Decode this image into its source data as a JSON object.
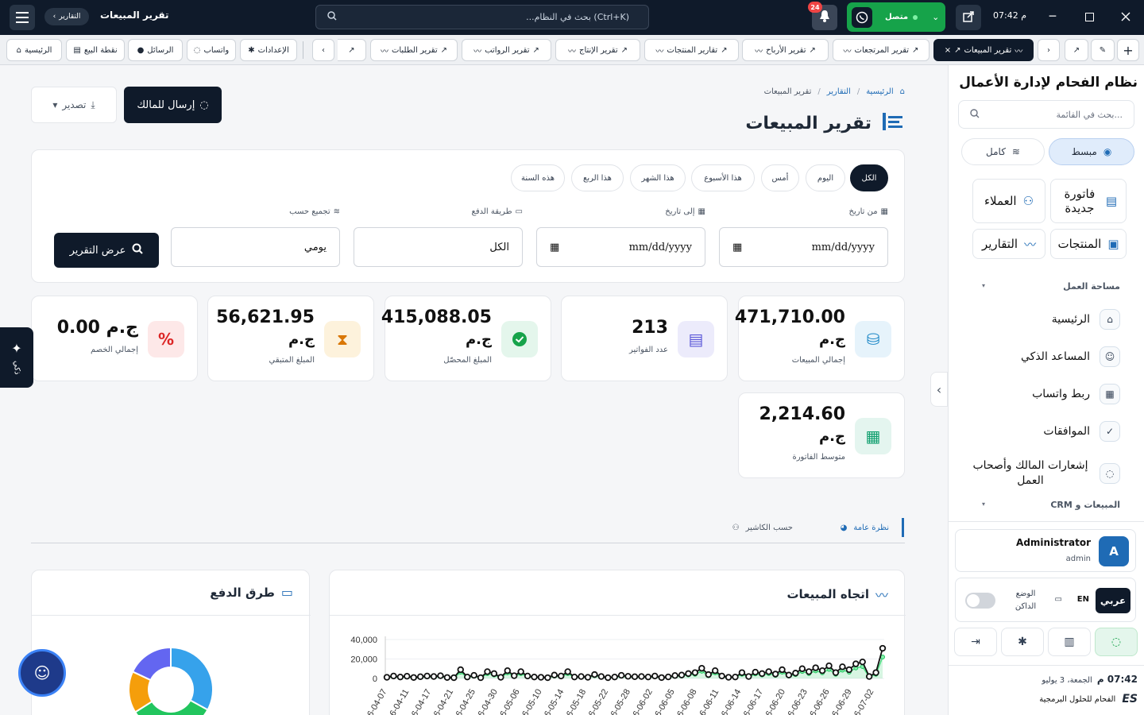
{
  "topbar": {
    "breadcrumb_pill": "التقارير",
    "page_title": "تقرير المبيعات",
    "search_placeholder": "...بحث في النظام (Ctrl+K)",
    "notification_count": "24",
    "status_label": "متصل",
    "time": "07:42 م"
  },
  "tabs": [
    {
      "label": "الرئيسية",
      "icon": "home-icon"
    },
    {
      "label": "نقطة البيع",
      "icon": "cash-register-icon"
    },
    {
      "label": "الرسائل",
      "icon": "chat-icon"
    },
    {
      "label": "واتساب",
      "icon": "whatsapp-icon"
    },
    {
      "label": "الإعدادات",
      "icon": "gear-icon"
    },
    {
      "label": "تقرير الطلبات",
      "icon": "chart-line-icon"
    },
    {
      "label": "تقرير الرواتب",
      "icon": "chart-line-icon"
    },
    {
      "label": "تقرير الإنتاج",
      "icon": "chart-line-icon"
    },
    {
      "label": "تقارير المنتجات",
      "icon": "chart-line-icon"
    },
    {
      "label": "تقرير الأرباح",
      "icon": "chart-line-icon"
    },
    {
      "label": "تقرير المرتجعات",
      "icon": "chart-line-icon"
    },
    {
      "label": "تقرير المبيعات",
      "icon": "chart-line-icon"
    }
  ],
  "breadcrumb": {
    "home": "الرئيسية",
    "reports": "التقارير",
    "current": "تقرير المبيعات"
  },
  "page": {
    "title": "تقرير المبيعات",
    "send_owner_label": "إرسال للمالك",
    "export_label": "تصدير"
  },
  "filters": {
    "periods": [
      "الكل",
      "اليوم",
      "أمس",
      "هذا الأسبوع",
      "هذا الشهر",
      "هذا الربع",
      "هذه السنة"
    ],
    "from_label": "من تاريخ",
    "to_label": "إلى تاريخ",
    "payment_label": "طريقة الدفع",
    "group_label": "تجميع حسب",
    "from_value": "mm/dd/yyyy",
    "to_value": "mm/dd/yyyy",
    "payment_value": "الكل",
    "group_value": "يومي",
    "show_report_label": "عرض التقرير"
  },
  "stats": [
    {
      "value": "471,710.00",
      "unit": "ج.م",
      "label": "إجمالي المبيعات",
      "icon": "coins-icon",
      "color": "#e6f3fb"
    },
    {
      "value": "213",
      "unit": "",
      "label": "عدد الفواتير",
      "icon": "invoice-icon",
      "color": "#ecebfb"
    },
    {
      "value": "415,088.05",
      "unit": "ج.م",
      "label": "المبلغ المحصّل",
      "icon": "check-circle-icon",
      "color": "#e4f6ec"
    },
    {
      "value": "56,621.95",
      "unit": "ج.م",
      "label": "المبلغ المتبقي",
      "icon": "hourglass-icon",
      "color": "#fdf2dc"
    },
    {
      "value": "0.00 ج.م",
      "unit": "",
      "label": "إجمالي الخصم",
      "icon": "percent-icon",
      "color": "#fde8e8"
    },
    {
      "value": "2,214.60",
      "unit": "ج.م",
      "label": "متوسط الفاتورة",
      "icon": "calculator-icon",
      "color": "#e4f5ef"
    }
  ],
  "report_tabs": {
    "overview": "نظرة عامة",
    "by_cashier": "حسب الكاشير"
  },
  "sales_chart_title": "اتجاه المبيعات",
  "payment_chart_title": "طرق الدفع",
  "ai_label": "ذكي",
  "chart_data": [
    {
      "type": "line",
      "title": "اتجاه المبيعات",
      "ylim": [
        0,
        40000
      ],
      "yticks": [
        "0",
        "20,000",
        "40,000"
      ],
      "x_tick_labels": [
        "6-04-07",
        "6-04-11",
        "6-04-17",
        "6-04-21",
        "6-04-25",
        "6-04-30",
        "6-05-06",
        "6-05-10",
        "6-05-14",
        "6-05-18",
        "6-05-22",
        "6-05-28",
        "6-06-02",
        "6-06-05",
        "6-06-08",
        "6-06-11",
        "6-06-14",
        "6-06-17",
        "6-06-20",
        "6-06-23",
        "6-06-26",
        "6-06-29",
        "6-07-02"
      ],
      "series": [
        {
          "values": [
            1200,
            2500,
            1500,
            2300,
            1000,
            1800,
            2500,
            2000,
            2800,
            1000,
            800,
            9000,
            1500,
            3200,
            800,
            7000,
            5000,
            1200,
            8000,
            2800,
            7000,
            2500,
            1500,
            1200,
            800,
            3500,
            2500,
            7000,
            1500,
            2000,
            1200,
            4000,
            2000,
            800,
            1500,
            3200,
            2200,
            1800,
            2000,
            1500,
            2500,
            900,
            1600,
            3000,
            3500,
            5000,
            6000,
            10500,
            4000,
            8000,
            2500,
            1200,
            1500,
            6000,
            2000,
            6500,
            5000,
            7000,
            4500,
            9000,
            3500,
            5500,
            10000,
            7000,
            11000,
            8000,
            13000,
            6000,
            12000,
            9000,
            15000,
            17000,
            2000,
            6000,
            31000
          ]
        },
        {
          "values": [
            800,
            1800,
            1100,
            1700,
            700,
            1300,
            1800,
            1500,
            2000,
            800,
            600,
            6500,
            1100,
            2400,
            600,
            5000,
            3600,
            900,
            5800,
            2000,
            5000,
            1800,
            1100,
            900,
            600,
            2500,
            1800,
            5000,
            1100,
            1500,
            900,
            2900,
            1500,
            600,
            1100,
            2300,
            1600,
            1300,
            1500,
            1100,
            1800,
            700,
            1200,
            2200,
            2500,
            3600,
            4300,
            7500,
            2900,
            5800,
            1800,
            900,
            1100,
            4300,
            1500,
            4700,
            3600,
            5000,
            3200,
            6500,
            2500,
            4000,
            7200,
            5000,
            7900,
            5800,
            9400,
            4300,
            8600,
            6500,
            10800,
            12200,
            1500,
            4300,
            22000
          ]
        }
      ]
    },
    {
      "type": "pie",
      "title": "طرق الدفع",
      "slices": [
        {
          "value": 33,
          "color": "#36a2eb"
        },
        {
          "value": 33,
          "color": "#22c55e"
        },
        {
          "value": 16,
          "color": "#f59e0b"
        },
        {
          "value": 18,
          "color": "#6366f1"
        }
      ]
    }
  ],
  "sidebar": {
    "app_title": "نظام الفحام لإدارة الأعمال",
    "search_placeholder": "بحث في القائمة...",
    "mode_simple": "مبسط",
    "mode_full": "كامل",
    "quick": [
      {
        "label": "فاتورة جديدة",
        "icon": "file-icon"
      },
      {
        "label": "العملاء",
        "icon": "users-icon"
      },
      {
        "label": "المنتجات",
        "icon": "box-icon"
      },
      {
        "label": "التقارير",
        "icon": "chart-line-icon"
      }
    ],
    "section_workspace": "مساحة العمل",
    "nav": [
      {
        "label": "الرئيسية",
        "icon": "home-icon"
      },
      {
        "label": "المساعد الذكي",
        "icon": "robot-icon"
      },
      {
        "label": "ربط واتساب",
        "icon": "qr-icon"
      },
      {
        "label": "الموافقات",
        "icon": "check-badge-icon"
      },
      {
        "label": "إشعارات المالك وأصحاب العمل",
        "icon": "whatsapp-icon"
      }
    ],
    "section_sales": "المبيعات و CRM",
    "user_name": "Administrator",
    "user_role": "admin",
    "user_initial": "A",
    "lang_ar": "عربي",
    "lang_en": "EN",
    "dark_mode": "الوضع الداكن",
    "clock": "07:42 م",
    "date": "الجمعة، 3 يوليو",
    "company": "الفحام للحلول البرمجية",
    "company_logo": "ES"
  }
}
